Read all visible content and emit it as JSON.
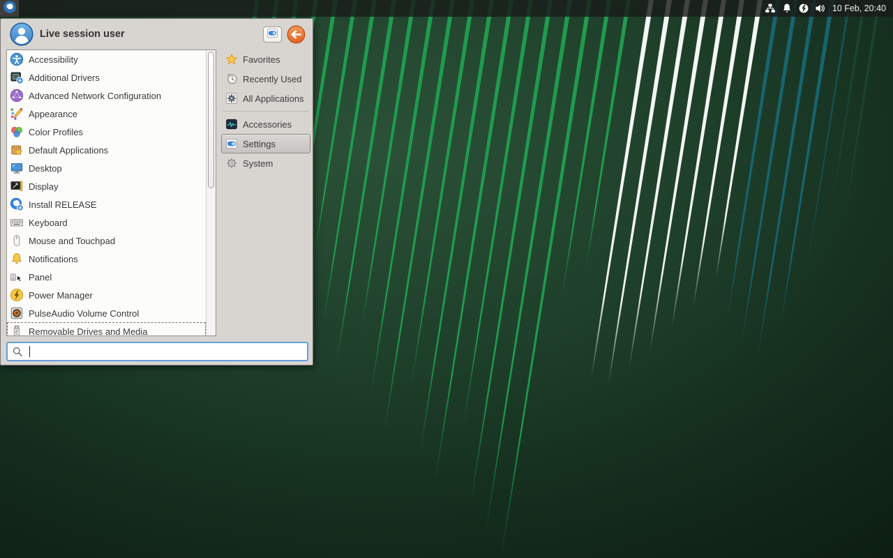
{
  "panel": {
    "clock": "10 Feb, 20:40",
    "whisker_button": {
      "icon": "whisker"
    },
    "tray": [
      {
        "name": "network",
        "icon": "network"
      },
      {
        "name": "notifications",
        "icon": "bell"
      },
      {
        "name": "power-manager",
        "icon": "power"
      },
      {
        "name": "volume",
        "icon": "volume"
      }
    ]
  },
  "menu": {
    "user": "Live session user",
    "header_buttons": [
      {
        "name": "all-settings",
        "icon": "settings"
      },
      {
        "name": "log-out",
        "icon": "log-out"
      }
    ],
    "apps": [
      {
        "label": "Accessibility",
        "icon": "accessibility"
      },
      {
        "label": "Additional Drivers",
        "icon": "additional-drivers"
      },
      {
        "label": "Advanced Network Configuration",
        "icon": "advanced-network-configuration"
      },
      {
        "label": "Appearance",
        "icon": "appearance"
      },
      {
        "label": "Color Profiles",
        "icon": "color-profiles"
      },
      {
        "label": "Default Applications",
        "icon": "default-applications"
      },
      {
        "label": "Desktop",
        "icon": "desktop"
      },
      {
        "label": "Display",
        "icon": "display"
      },
      {
        "label": "Install RELEASE",
        "icon": "install-release"
      },
      {
        "label": "Keyboard",
        "icon": "keyboard"
      },
      {
        "label": "Mouse and Touchpad",
        "icon": "mouse-and-touchpad"
      },
      {
        "label": "Notifications",
        "icon": "notifications"
      },
      {
        "label": "Panel",
        "icon": "panel"
      },
      {
        "label": "Power Manager",
        "icon": "power-manager"
      },
      {
        "label": "PulseAudio Volume Control",
        "icon": "pulseaudio-volume-control"
      },
      {
        "label": "Removable Drives and Media",
        "icon": "removable-drives-and-media",
        "focused": true
      }
    ],
    "categories": [
      {
        "label": "Favorites",
        "icon": "favorites"
      },
      {
        "label": "Recently Used",
        "icon": "recently-used"
      },
      {
        "label": "All Applications",
        "icon": "all-applications"
      },
      {
        "label": "Accessories",
        "icon": "accessories",
        "new_group": true
      },
      {
        "label": "Settings",
        "icon": "settings",
        "selected": true
      },
      {
        "label": "System",
        "icon": "system"
      }
    ],
    "search": {
      "value": "",
      "placeholder": ""
    }
  },
  "colors": {
    "accent_blue": "#3689e6",
    "search_focus_border": "#63a1d8",
    "menu_bg": "#d8d5d1",
    "panel_bg": "#1a1c1a",
    "wallpaper_green_streak": "#1f9b4e",
    "wallpaper_white_streak": "#f3f6f3",
    "wallpaper_teal_streak": "#17646f",
    "logout_orange": "#e2631c"
  }
}
